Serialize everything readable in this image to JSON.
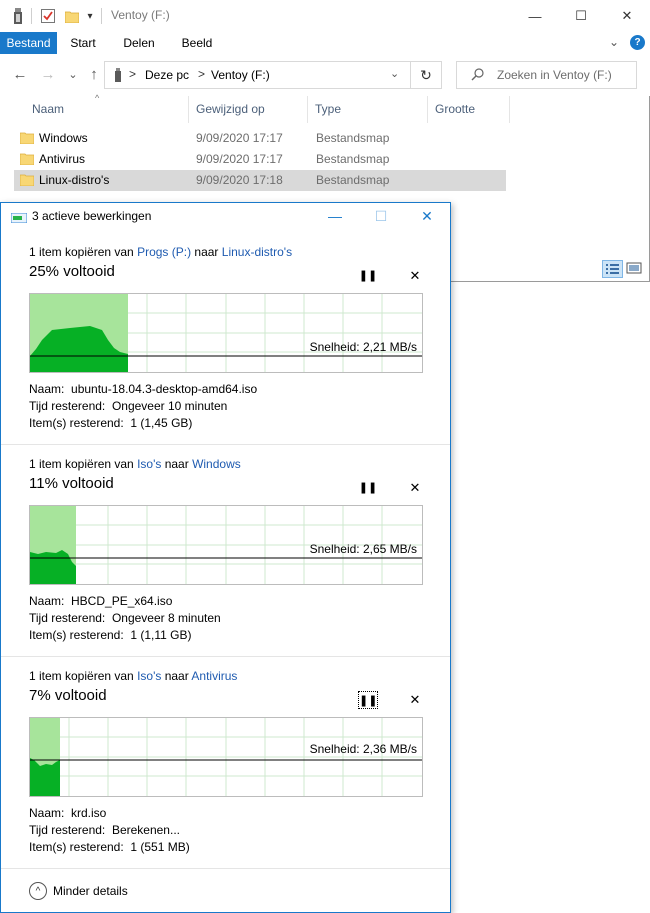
{
  "explorer": {
    "title": "Ventoy (F:)",
    "icons": [
      "usb-drive-icon",
      "properties-check-icon",
      "new-folder-icon",
      "customize-dropdown-icon"
    ],
    "window_buttons": {
      "minimize": "—",
      "maximize": "☐",
      "close": "✕"
    },
    "ribbon": {
      "tabs": [
        "Bestand",
        "Start",
        "Delen",
        "Beeld"
      ],
      "active_tab": "Bestand",
      "expand_icon": "chevron-down-icon",
      "help_icon": "help-icon"
    },
    "nav": {
      "back": "←",
      "forward": "→",
      "recent": "⌄",
      "up": "↑",
      "breadcrumb": [
        "Deze pc",
        "Ventoy (F:)"
      ],
      "separator": ">",
      "refresh": "↻",
      "search_placeholder": "Zoeken in Ventoy (F:)"
    },
    "columns": {
      "name": "Naam",
      "modified": "Gewijzigd op",
      "type": "Type",
      "size": "Grootte"
    },
    "files": [
      {
        "name": "Windows",
        "modified": "9/09/2020 17:17",
        "type": "Bestandsmap",
        "selected": false
      },
      {
        "name": "Antivirus",
        "modified": "9/09/2020 17:17",
        "type": "Bestandsmap",
        "selected": false
      },
      {
        "name": "Linux-distro's",
        "modified": "9/09/2020 17:18",
        "type": "Bestandsmap",
        "selected": true
      }
    ]
  },
  "dialog": {
    "title": "3 actieve bewerkingen",
    "buttons": {
      "minimize": "—",
      "maximize": "☐",
      "close": "✕"
    },
    "operations": [
      {
        "prefix": "1 item kopiëren van ",
        "source": "Progs (P:)",
        "middle": " naar ",
        "dest": "Linux-distro's",
        "percent_text": "25% voltooid",
        "progress": 0.25,
        "speed_text": "Snelheid: 2,21 MB/s",
        "speed_level": 0.2,
        "name_label": "Naam:",
        "name_value": "ubuntu-18.04.3-desktop-amd64.iso",
        "time_label": "Tijd resterend:",
        "time_value": "Ongeveer 10 minuten",
        "items_label": "Item(s) resterend:",
        "items_value": "1 (1,45 GB)",
        "pause_focused": false
      },
      {
        "prefix": "1 item kopiëren van ",
        "source": "Iso's",
        "middle": " naar ",
        "dest": "Windows",
        "percent_text": "11% voltooid",
        "progress": 0.11,
        "speed_text": "Snelheid: 2,65 MB/s",
        "speed_level": 0.32,
        "name_label": "Naam:",
        "name_value": "HBCD_PE_x64.iso",
        "time_label": "Tijd resterend:",
        "time_value": "Ongeveer 8 minuten",
        "items_label": "Item(s) resterend:",
        "items_value": "1 (1,11 GB)",
        "pause_focused": false
      },
      {
        "prefix": "1 item kopiëren van ",
        "source": "Iso's",
        "middle": " naar ",
        "dest": "Antivirus",
        "percent_text": "7% voltooid",
        "progress": 0.07,
        "speed_text": "Snelheid: 2,36 MB/s",
        "speed_level": 0.37,
        "name_label": "Naam:",
        "name_value": "krd.iso",
        "time_label": "Tijd resterend:",
        "time_value": "Berekenen...",
        "items_label": "Item(s) resterend:",
        "items_value": "1 (551 MB)",
        "pause_focused": true
      }
    ],
    "pause_glyph": "❚❚",
    "cancel_glyph": "✕",
    "less_details": "Minder details",
    "less_icon": "^"
  },
  "colors": {
    "accent": "#1979ca",
    "link": "#1f5bb0",
    "graph_fill": "#06b025",
    "graph_done": "#a7e49b",
    "grid": "#cfe9cf",
    "selection": "#d9d9d9"
  }
}
